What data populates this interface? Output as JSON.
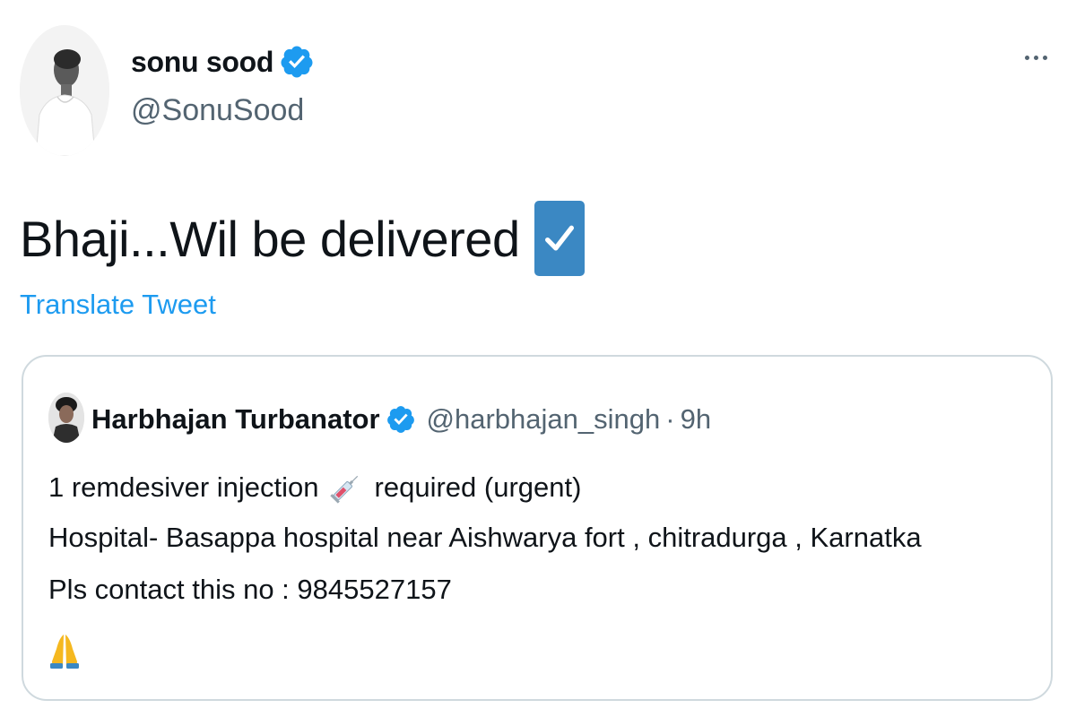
{
  "tweet": {
    "author": {
      "name": "sonu sood",
      "handle": "@SonuSood",
      "verified": true
    },
    "text": "Bhaji...Wil be delivered",
    "text_emoji": "check-mark-button-icon",
    "translate_label": "Translate Tweet",
    "more_icon": "more-options-icon"
  },
  "quoted_tweet": {
    "author": {
      "name": "Harbhajan Turbanator",
      "handle": "@harbhajan_singh",
      "separator": "·",
      "time": "9h",
      "verified": true
    },
    "lines": {
      "line1_before": "1 remdesiver injection",
      "line1_emoji": "syringe-icon",
      "line1_after": "required (urgent)",
      "line2": " Hospital- Basappa hospital near Aishwarya fort , chitradurga , Karnatka",
      "line3": "Pls contact this no : 9845527157",
      "line4_emoji": "folded-hands-icon"
    }
  },
  "colors": {
    "accent": "#1d9bf0",
    "secondary_text": "#536471",
    "border": "#cfd9de",
    "check_emoji_bg": "#3b88c3"
  }
}
